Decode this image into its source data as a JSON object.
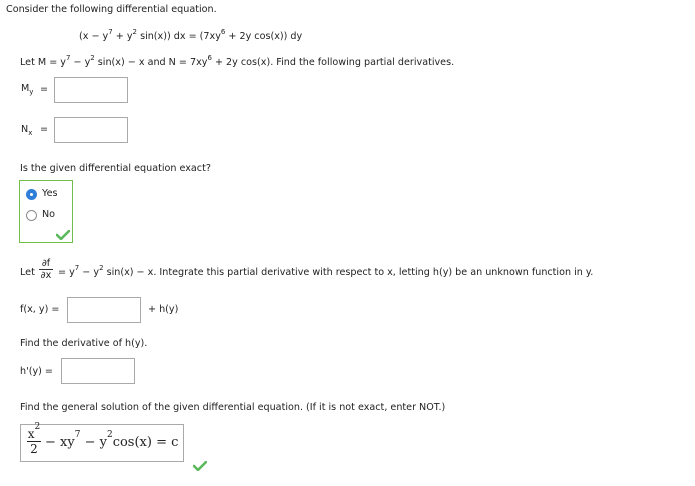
{
  "intro": "Consider the following differential equation.",
  "equation": {
    "part1": "(x − y",
    "exp1": "7",
    "part2": " + y",
    "exp2": "2",
    "part3": " sin(x)) dx = (7xy",
    "exp3": "6",
    "part4": " + 2y cos(x)) dy"
  },
  "let_mn": {
    "a": "Let M = y",
    "e1": "7",
    "b": " − y",
    "e2": "2",
    "c": " sin(x) − x and N = 7xy",
    "e3": "6",
    "d": " + 2y cos(x). Find the following partial derivatives."
  },
  "my": {
    "main": "M",
    "sub": "y",
    "eq": "=",
    "value": ""
  },
  "nx": {
    "main": "N",
    "sub": "x",
    "eq": "=",
    "value": ""
  },
  "exact_question": "Is the given differential equation exact?",
  "options": [
    {
      "label": "Yes",
      "selected": true
    },
    {
      "label": "No",
      "selected": false
    }
  ],
  "partial": {
    "let": "Let",
    "num": "∂f",
    "den": "∂x",
    "a": "= y",
    "e1": "7",
    "b": " − y",
    "e2": "2",
    "c": " sin(x) − x. Integrate this partial derivative with respect to x, letting h(y) be an unknown function in y."
  },
  "fxy": {
    "label": "f(x, y) =",
    "value": "",
    "suffix": "+ h(y)"
  },
  "find_h": "Find the derivative of h(y).",
  "hprime": {
    "label": "h'(y) =",
    "value": ""
  },
  "general_prompt": "Find the general solution of the given differential equation. (If it is not exact, enter NOT.)",
  "answer": {
    "num": "x",
    "num_exp": "2",
    "den": "2",
    "t1": "− xy",
    "t1e": "7",
    "t2": " − y",
    "t2e": "2",
    "t3": "cos(x) = c"
  },
  "colors": {
    "accent": "#2f7fd8",
    "correct": "#5cb85c",
    "border_correct": "#6fbf4a"
  }
}
